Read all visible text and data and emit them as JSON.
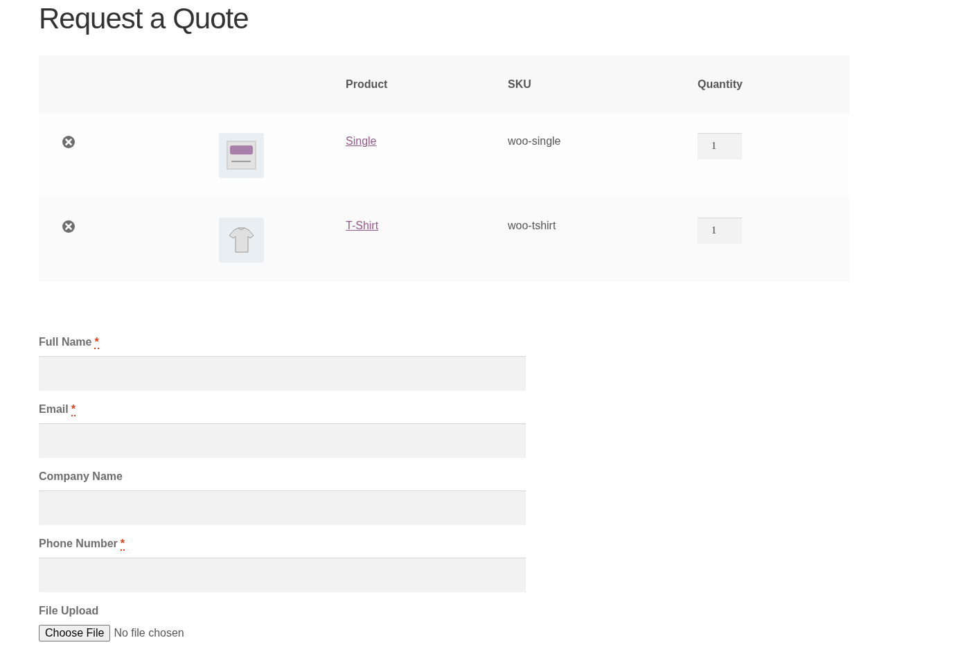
{
  "title": "Request a Quote",
  "table": {
    "columns": [
      "Product",
      "SKU",
      "Quantity"
    ],
    "rows": [
      {
        "product": "Single",
        "sku": "woo-single",
        "quantity": "1"
      },
      {
        "product": "T-Shirt",
        "sku": "woo-tshirt",
        "quantity": "1"
      }
    ]
  },
  "form": {
    "fields": [
      {
        "kind": "text",
        "label": "Full Name",
        "asterisk": "*"
      },
      {
        "kind": "text",
        "label": "Email",
        "asterisk": "*"
      },
      {
        "kind": "text",
        "label": "Company Name"
      },
      {
        "kind": "text",
        "label": "Phone Number",
        "asterisk": "*"
      },
      {
        "kind": "file",
        "label": "File Upload",
        "button": "Choose File",
        "status": "No file chosen"
      }
    ]
  }
}
